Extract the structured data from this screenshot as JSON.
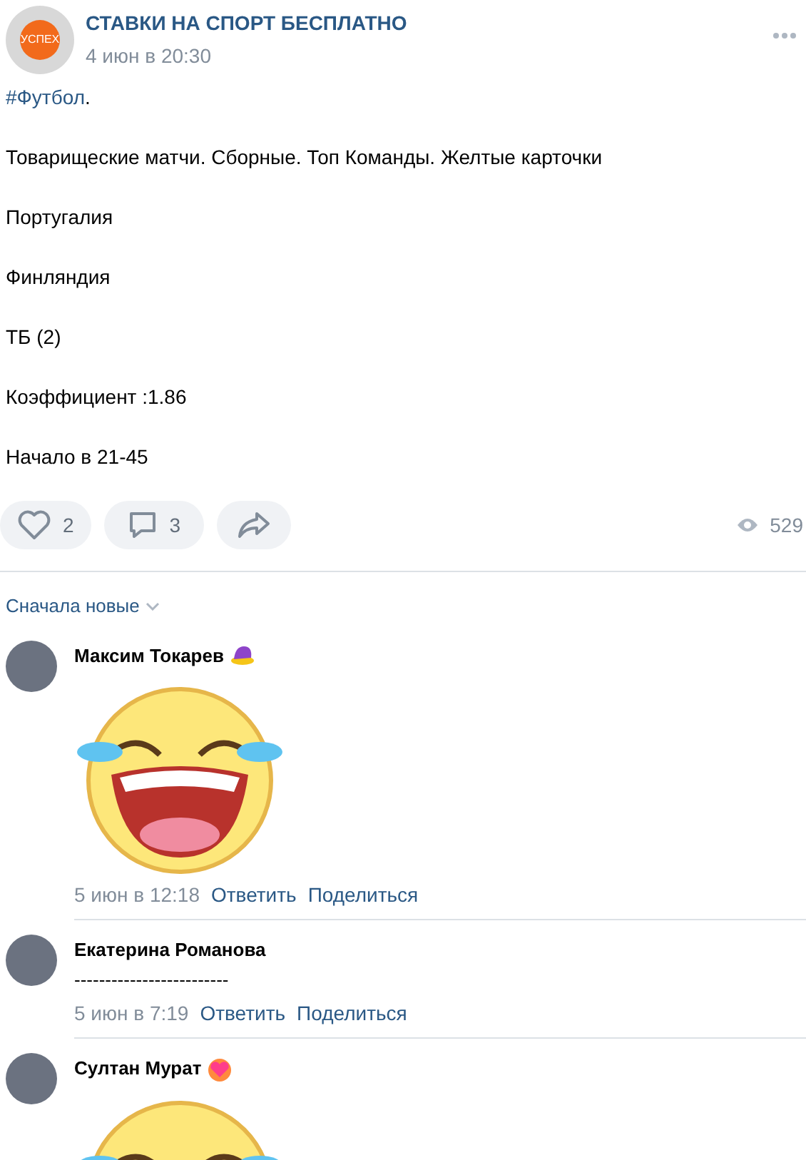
{
  "post": {
    "author": "СТАВКИ НА СПОРТ БЕСПЛАТНО",
    "avatar_text": "УСПЕХ",
    "date": "4 июн в 20:30",
    "hashtag": "#Футбол",
    "hashtag_tail": ".",
    "paragraphs": [
      "Товарищеские матчи. Сборные. Топ Команды. Желтые карточки",
      "Португалия",
      "Финляндия",
      "ТБ (2)",
      "Коэффициент :1.86",
      "Начало в 21-45"
    ],
    "likes": "2",
    "comments": "3",
    "views": "529"
  },
  "sort": {
    "label": "Сначала новые"
  },
  "comments": [
    {
      "name": "Максим Токарев",
      "badge": {
        "kind": "hat"
      },
      "kind": "sticker",
      "date": "5 июн в 12:18",
      "reply": "Ответить",
      "share": "Поделиться"
    },
    {
      "name": "Екатерина Романова",
      "kind": "text",
      "text": "-------------------------",
      "date": "5 июн в 7:19",
      "reply": "Ответить",
      "share": "Поделиться"
    },
    {
      "name": "Султан Мурат",
      "badge": {
        "kind": "heart"
      },
      "kind": "sticker"
    }
  ]
}
